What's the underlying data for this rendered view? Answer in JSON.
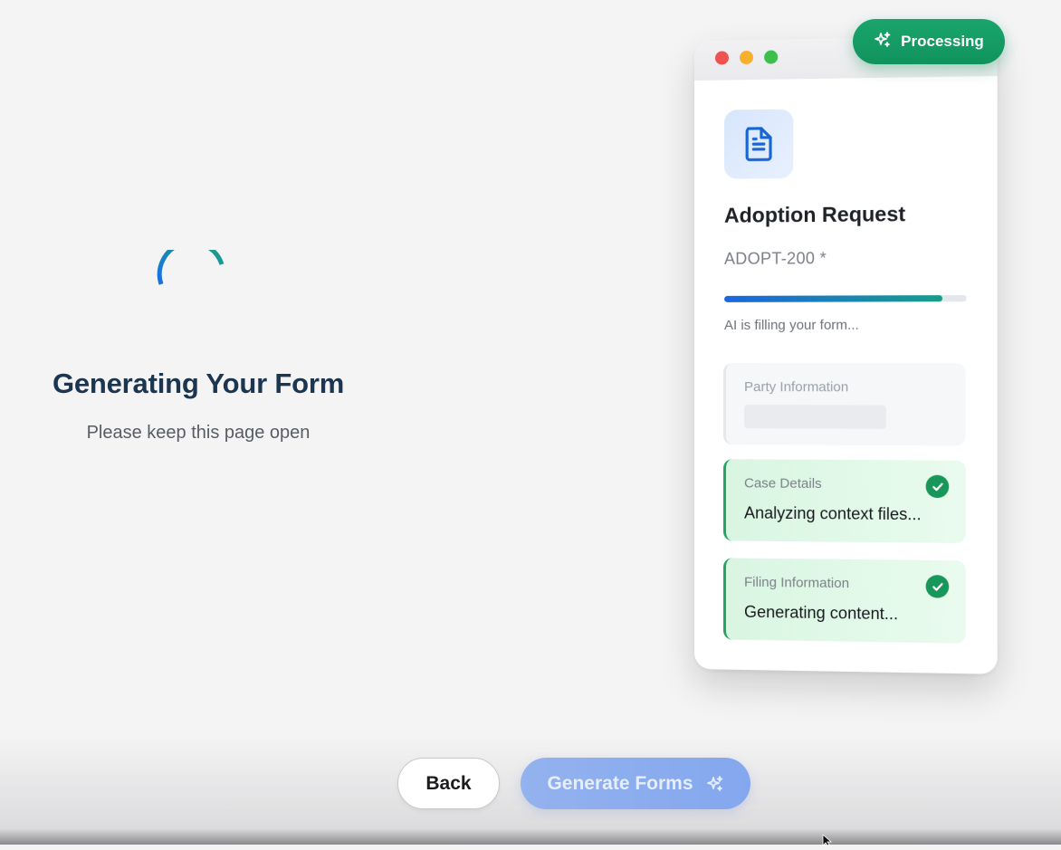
{
  "status": {
    "title": "Generating Your Form",
    "subtitle": "Please keep this page open",
    "spinner_icon": "loading-spinner-icon"
  },
  "footer": {
    "back_label": "Back",
    "generate_label": "Generate Forms",
    "generate_icon": "sparkle-icon"
  },
  "preview": {
    "processing_label": "Processing",
    "processing_icon": "sparkle-icon",
    "doc_icon": "document-icon",
    "form_title": "Adoption Request",
    "form_code": "ADOPT-200 *",
    "progress_fraction": 0.9,
    "progress_label": "AI is filling your form...",
    "sections": [
      {
        "label": "Party Information",
        "state": "pending"
      },
      {
        "label": "Case Details",
        "value": "Analyzing context files...",
        "state": "done"
      },
      {
        "label": "Filing Information",
        "value": "Generating content...",
        "state": "done"
      }
    ]
  },
  "colors": {
    "accent_green": "#10935c",
    "title_navy": "#1c3550",
    "progress_start": "#1a66e0",
    "progress_end": "#199c8a",
    "generate_button": "#8aacee"
  }
}
